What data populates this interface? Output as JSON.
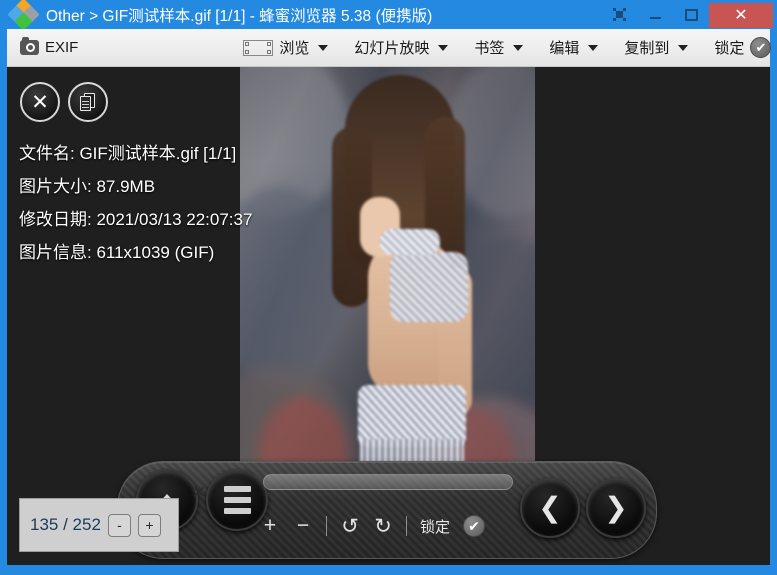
{
  "window": {
    "title": "Other > GIF测试样本.gif [1/1] - 蜂蜜浏览器 5.38 (便携版)",
    "accent_color": "#2489e0",
    "close_color": "#c85454",
    "buttons": {
      "snapshot": "snapshot-icon",
      "minimize": "minimize-icon",
      "maximize": "maximize-icon",
      "close": "✕"
    }
  },
  "toolbar": {
    "exif_label": "EXIF",
    "items": [
      {
        "label": "浏览",
        "icon": "browse-icon",
        "caret": true
      },
      {
        "label": "幻灯片放映",
        "icon": "",
        "caret": true
      },
      {
        "label": "书签",
        "icon": "",
        "caret": true
      },
      {
        "label": "编辑",
        "icon": "",
        "caret": true
      },
      {
        "label": "复制到",
        "icon": "",
        "caret": true
      }
    ],
    "lock_label": "锁定",
    "lock_check": "✔"
  },
  "overlay_buttons": {
    "close": "✕",
    "copy": "copy-document-icon"
  },
  "info": {
    "filename": "文件名: GIF测试样本.gif [1/1]",
    "filesize": "图片大小: 87.9MB",
    "modified": "修改日期: 2021/03/13 22:07:37",
    "imageinfo": "图片信息: 611x1039 (GIF)"
  },
  "bottombar": {
    "up_label": "up-arrow",
    "menu_label": "menu",
    "prev": "❮",
    "next": "❯",
    "zoom_in": "+",
    "zoom_out": "−",
    "rotate_left": "↺",
    "rotate_right": "↻",
    "lock_label": "锁定",
    "lock_check": "✔"
  },
  "page_popup": {
    "count": "135 / 252",
    "minus": "-",
    "plus": "+",
    "close": "✕"
  }
}
